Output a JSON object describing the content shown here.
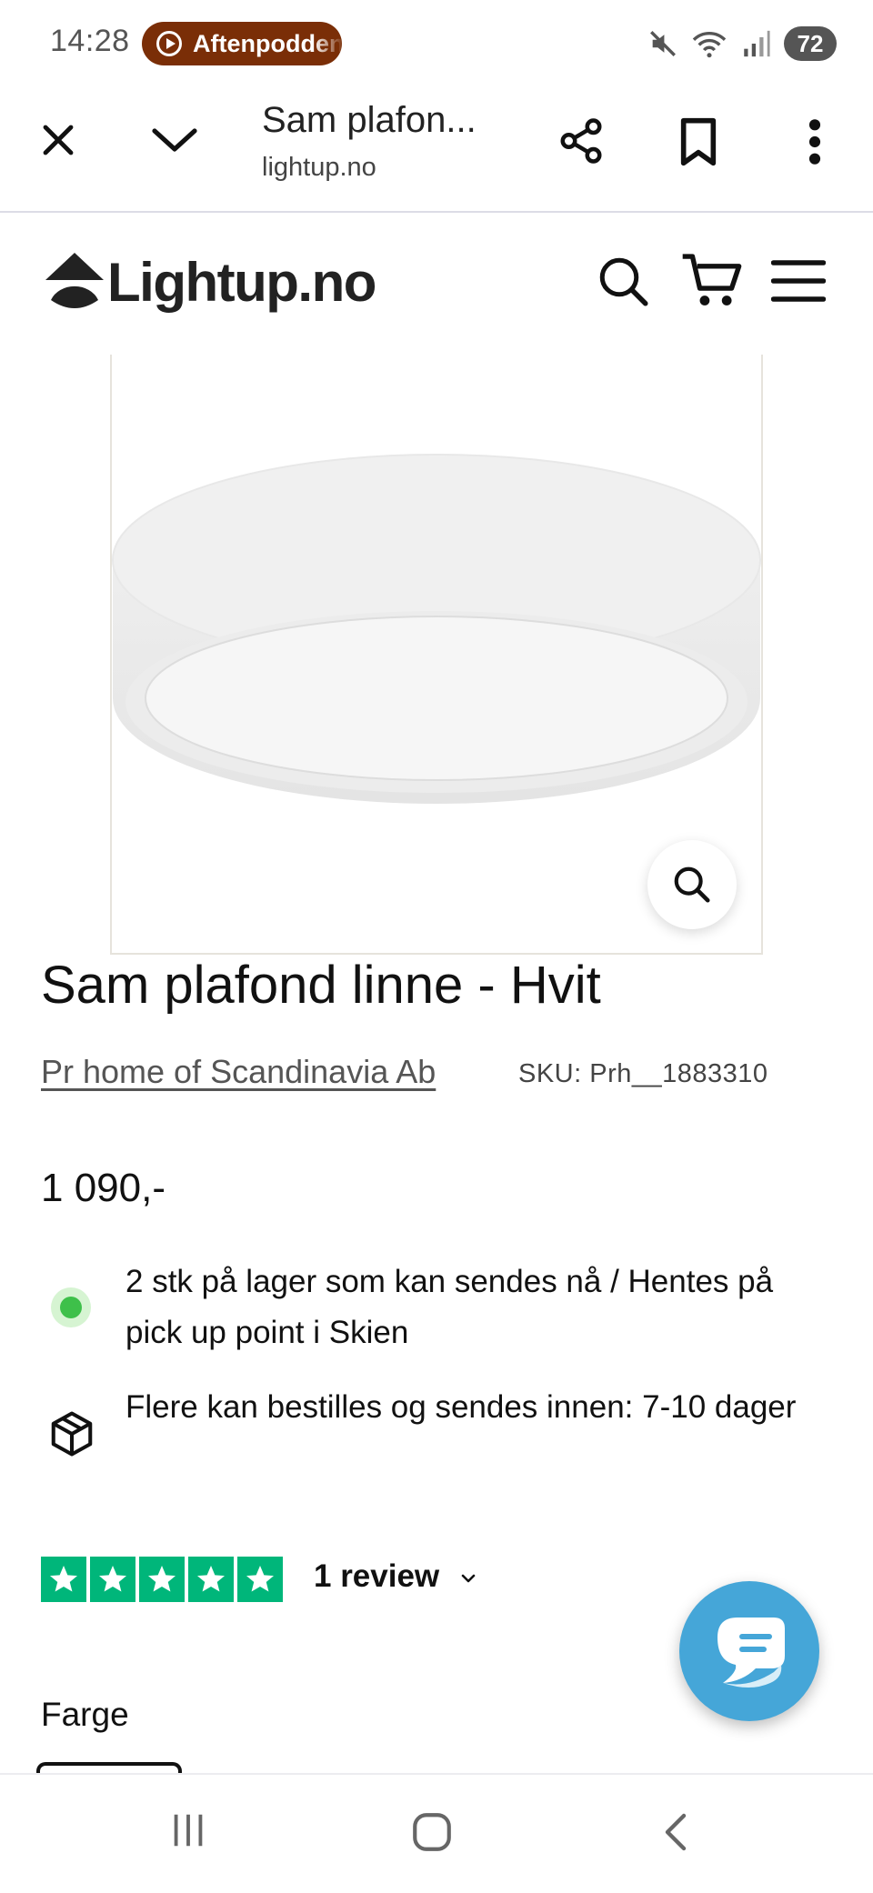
{
  "status_bar": {
    "time": "14:28",
    "media_pill": "Aftenpodden",
    "battery": "72",
    "icons": [
      "mute-icon",
      "wifi-icon",
      "signal-icon",
      "battery-icon"
    ]
  },
  "browser": {
    "title": "Sam plafon...",
    "url": "lightup.no",
    "icons": [
      "close-icon",
      "chevron-down-icon",
      "share-icon",
      "bookmark-icon",
      "more-vertical-icon"
    ]
  },
  "site": {
    "logo_text": "Lightup.no",
    "header_icons": [
      "search-icon",
      "cart-icon",
      "menu-icon"
    ]
  },
  "product": {
    "title": "Sam plafond linne - Hvit",
    "brand": "Pr home of Scandinavia Ab",
    "sku": "SKU: Prh__1883310",
    "price": "1 090,-",
    "stock_text": "2 stk på lager som kan sendes nå / Hentes på pick up point i Skien",
    "order_text": "Flere kan bestilles og sendes innen: 7-10 dager",
    "rating_stars": 5,
    "review_label": "1 review",
    "option_label": "Farge"
  },
  "colors": {
    "accent_pill": "#7a2e07",
    "trustpilot_green": "#00b67a",
    "stock_green": "#3ec04a",
    "chat_blue": "#45a6d8"
  }
}
